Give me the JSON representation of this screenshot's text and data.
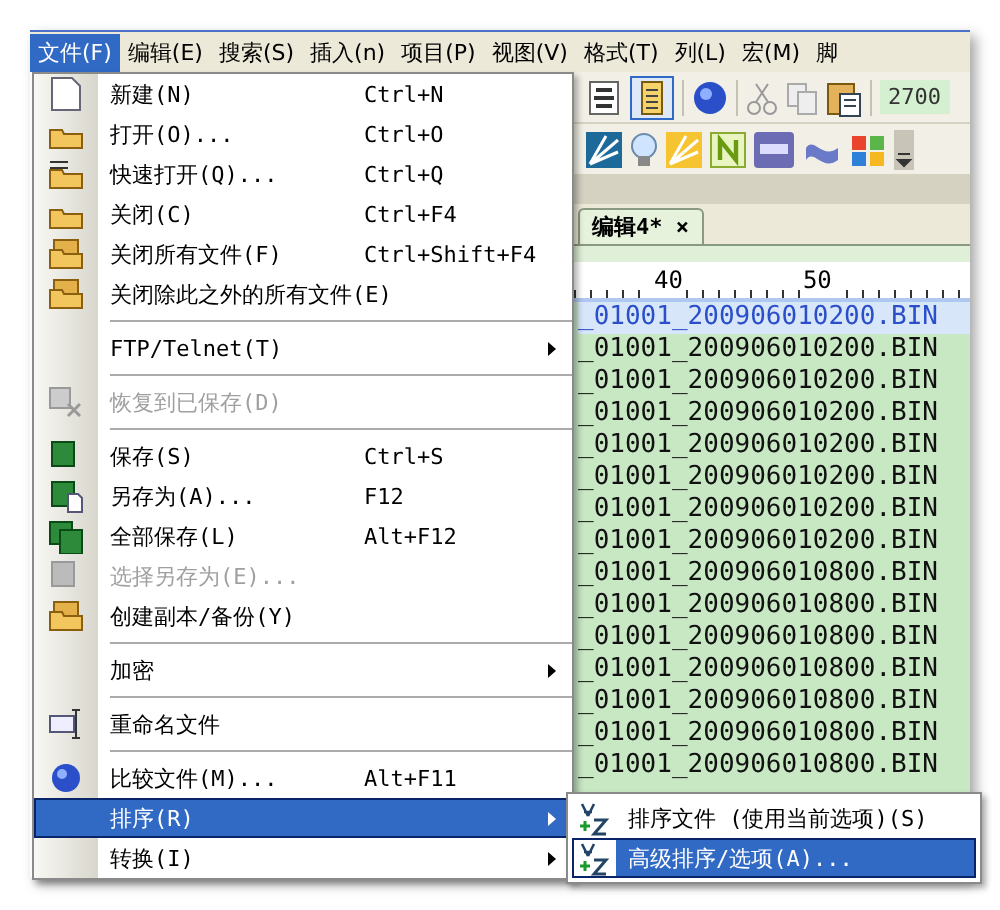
{
  "menu_bar": [
    {
      "label": "文件(F)",
      "selected": true
    },
    {
      "label": "编辑(E)",
      "selected": false
    },
    {
      "label": "搜索(S)",
      "selected": false
    },
    {
      "label": "插入(n)",
      "selected": false
    },
    {
      "label": "项目(P)",
      "selected": false
    },
    {
      "label": "视图(V)",
      "selected": false
    },
    {
      "label": "格式(T)",
      "selected": false
    },
    {
      "label": "列(L)",
      "selected": false
    },
    {
      "label": "宏(M)",
      "selected": false
    },
    {
      "label": "脚",
      "selected": false
    }
  ],
  "toolbar": {
    "field_value": "2700"
  },
  "editor_tab": {
    "label": "编辑4*",
    "close": "×"
  },
  "ruler": [
    "40",
    "50"
  ],
  "lines": [
    {
      "text": "_01001_200906010200.BIN",
      "selected": true
    },
    {
      "text": "_01001_200906010200.BIN",
      "selected": false
    },
    {
      "text": "_01001_200906010200.BIN",
      "selected": false
    },
    {
      "text": "_01001_200906010200.BIN",
      "selected": false
    },
    {
      "text": "_01001_200906010200.BIN",
      "selected": false
    },
    {
      "text": "_01001_200906010200.BIN",
      "selected": false
    },
    {
      "text": "_01001_200906010200.BIN",
      "selected": false
    },
    {
      "text": "_01001_200906010200.BIN",
      "selected": false
    },
    {
      "text": "_01001_200906010800.BIN",
      "selected": false
    },
    {
      "text": "_01001_200906010800.BIN",
      "selected": false
    },
    {
      "text": "_01001_200906010800.BIN",
      "selected": false
    },
    {
      "text": "_01001_200906010800.BIN",
      "selected": false
    },
    {
      "text": "_01001_200906010800.BIN",
      "selected": false
    },
    {
      "text": "_01001_200906010800.BIN",
      "selected": false
    },
    {
      "text": "_01001_200906010800.BIN",
      "selected": false
    }
  ],
  "file_menu": [
    {
      "kind": "item",
      "label": "新建(N)",
      "shortcut": "Ctrl+N",
      "disabled": false,
      "selected": false,
      "submenu": false
    },
    {
      "kind": "item",
      "label": "打开(O)...",
      "shortcut": "Ctrl+O",
      "disabled": false,
      "selected": false,
      "submenu": false
    },
    {
      "kind": "item",
      "label": "快速打开(Q)...",
      "shortcut": "Ctrl+Q",
      "disabled": false,
      "selected": false,
      "submenu": false
    },
    {
      "kind": "item",
      "label": "关闭(C)",
      "shortcut": "Ctrl+F4",
      "disabled": false,
      "selected": false,
      "submenu": false
    },
    {
      "kind": "item",
      "label": "关闭所有文件(F)",
      "shortcut": "Ctrl+Shift+F4",
      "disabled": false,
      "selected": false,
      "submenu": false
    },
    {
      "kind": "item",
      "label": "关闭除此之外的所有文件(E)",
      "disabled": false,
      "selected": false,
      "submenu": false
    },
    {
      "kind": "separator"
    },
    {
      "kind": "item",
      "label": "FTP/Telnet(T)",
      "disabled": false,
      "selected": false,
      "submenu": true
    },
    {
      "kind": "separator"
    },
    {
      "kind": "item",
      "label": "恢复到已保存(D)",
      "disabled": true,
      "selected": false,
      "submenu": false
    },
    {
      "kind": "separator"
    },
    {
      "kind": "item",
      "label": "保存(S)",
      "shortcut": "Ctrl+S",
      "disabled": false,
      "selected": false,
      "submenu": false
    },
    {
      "kind": "item",
      "label": "另存为(A)...",
      "shortcut": "F12",
      "disabled": false,
      "selected": false,
      "submenu": false
    },
    {
      "kind": "item",
      "label": "全部保存(L)",
      "shortcut": "Alt+F12",
      "disabled": false,
      "selected": false,
      "submenu": false
    },
    {
      "kind": "item",
      "label": "选择另存为(E)...",
      "disabled": true,
      "selected": false,
      "submenu": false
    },
    {
      "kind": "item",
      "label": "创建副本/备份(Y)",
      "disabled": false,
      "selected": false,
      "submenu": false
    },
    {
      "kind": "separator"
    },
    {
      "kind": "item",
      "label": "加密",
      "disabled": false,
      "selected": false,
      "submenu": true
    },
    {
      "kind": "separator"
    },
    {
      "kind": "item",
      "label": "重命名文件",
      "disabled": false,
      "selected": false,
      "submenu": false
    },
    {
      "kind": "separator"
    },
    {
      "kind": "item",
      "label": "比较文件(M)...",
      "shortcut": "Alt+F11",
      "disabled": false,
      "selected": false,
      "submenu": false
    },
    {
      "kind": "item",
      "label": "排序(R)",
      "disabled": false,
      "selected": true,
      "submenu": true
    },
    {
      "kind": "item",
      "label": "转换(I)",
      "disabled": false,
      "selected": false,
      "submenu": true
    }
  ],
  "sort_submenu": [
    {
      "label": "排序文件 (使用当前选项)(S)",
      "selected": false
    },
    {
      "label": "高级排序/选项(A)...",
      "selected": true
    }
  ]
}
